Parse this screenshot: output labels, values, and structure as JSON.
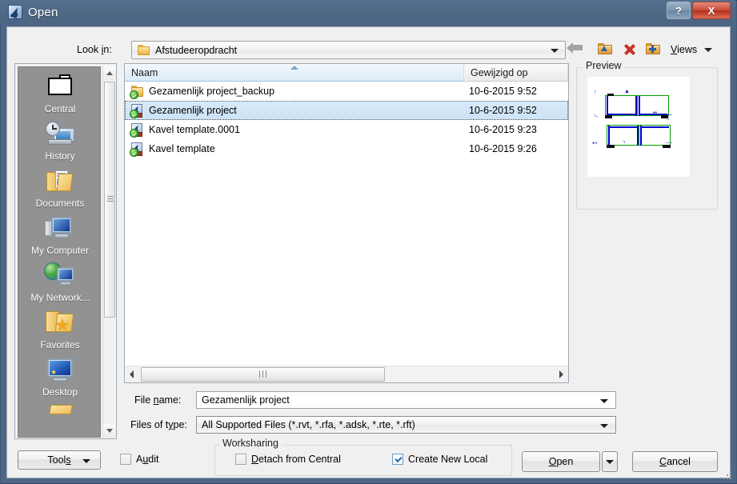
{
  "window": {
    "title": "Open",
    "icon": "revit-app-icon",
    "buttons": {
      "help": "?",
      "close": "X"
    },
    "titlebar_color": "#4e6885",
    "close_color": "#cc4b37"
  },
  "lookin": {
    "label_pre": "Look ",
    "label_accel": "i",
    "label_post": "n:",
    "value": "Afstudeeropdracht",
    "icon": "folder-icon",
    "arrow_icon": "chevron-down-icon"
  },
  "toolbar": {
    "back": "back-arrow-icon",
    "up": "up-one-level-icon",
    "delete": "delete-icon",
    "newfolder": "new-folder-icon",
    "views_pre": "V",
    "views_accel": "",
    "views_label": "iews",
    "views_full": "Views"
  },
  "places": {
    "items": [
      {
        "label": "Central",
        "icon": "central-folder-icon"
      },
      {
        "label": "History",
        "icon": "history-icon"
      },
      {
        "label": "Documents",
        "icon": "documents-folder-icon"
      },
      {
        "label": "My Computer",
        "icon": "my-computer-icon"
      },
      {
        "label": "My Network...",
        "icon": "my-network-icon"
      },
      {
        "label": "Favorites",
        "icon": "favorites-folder-icon"
      },
      {
        "label": "Desktop",
        "icon": "desktop-icon"
      }
    ]
  },
  "filelist": {
    "columns": [
      {
        "key": "name",
        "label": "Naam",
        "sorted": "asc"
      },
      {
        "key": "date",
        "label": "Gewijzigd op",
        "sorted": ""
      }
    ],
    "rows": [
      {
        "name": "Gezamenlijk project_backup",
        "date": "10-6-2015 9:52",
        "icon": "folder-icon",
        "overlay": "sync-badge",
        "selected": false
      },
      {
        "name": "Gezamenlijk project",
        "date": "10-6-2015 9:52",
        "icon": "revit-file-icon",
        "overlay": "sync-badge",
        "selected": true
      },
      {
        "name": "Kavel template.0001",
        "date": "10-6-2015 9:23",
        "icon": "revit-file-icon",
        "overlay": "sync-badge",
        "selected": false
      },
      {
        "name": "Kavel template",
        "date": "10-6-2015 9:26",
        "icon": "revit-file-icon",
        "overlay": "sync-badge",
        "selected": false
      }
    ]
  },
  "preview": {
    "legend": "Preview",
    "content_description": "revit-floor-plan-thumbnail"
  },
  "form": {
    "filename_label_pre": "File ",
    "filename_label_accel": "n",
    "filename_label_post": "ame:",
    "filename_value": "Gezamenlijk project",
    "filename_full_label": "File name:",
    "filetype_label_pre": "Files of t",
    "filetype_label_accel": "y",
    "filetype_label_post": "pe:",
    "filetype_full_label": "Files of type:",
    "filetype_value": "All Supported Files  (*.rvt, *.rfa, *.adsk, *.rte, *.rft)"
  },
  "footer": {
    "tools_pre": "Tool",
    "tools_accel": "s",
    "tools_full": "Tools",
    "audit_pre": "A",
    "audit_accel": "u",
    "audit_post": "dit",
    "audit_full": "Audit",
    "audit_checked": false,
    "worksharing_legend": "Worksharing",
    "detach_pre": "",
    "detach_accel": "D",
    "detach_post": "etach from Central",
    "detach_full": "Detach from Central",
    "detach_checked": false,
    "newlocal_full": "Create New Local",
    "newlocal_checked": true,
    "open_pre": "",
    "open_accel": "O",
    "open_post": "pen",
    "open_full": "Open",
    "cancel_pre": "",
    "cancel_accel": "C",
    "cancel_post": "ancel",
    "cancel_full": "Cancel"
  }
}
